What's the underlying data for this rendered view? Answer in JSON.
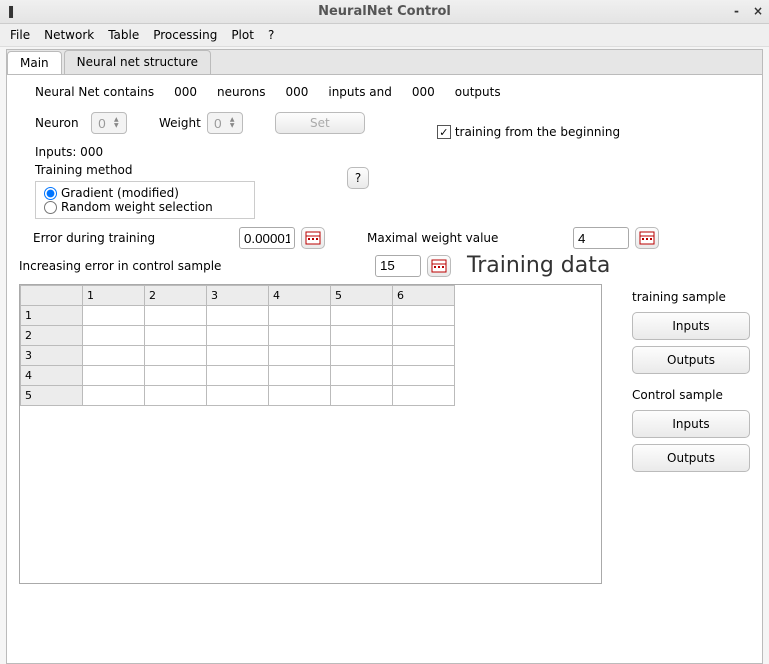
{
  "window": {
    "title": "NeuralNet Control"
  },
  "menu": {
    "file": "File",
    "network": "Network",
    "table": "Table",
    "processing": "Processing",
    "plot": "Plot",
    "help": "?"
  },
  "tabs": {
    "main": "Main",
    "structure": "Neural net structure"
  },
  "summary": {
    "prefix": "Neural Net contains",
    "neurons_count": "000",
    "neurons_label": "neurons",
    "inputs_count": "000",
    "inputs_label": "inputs and",
    "outputs_count": "000",
    "outputs_label": "outputs"
  },
  "neuron": {
    "label": "Neuron",
    "value": "0"
  },
  "weight": {
    "label": "Weight",
    "value": "0"
  },
  "set_button": "Set",
  "training_checkbox": {
    "checked": true,
    "label": "training from the beginning"
  },
  "inputs_line": "Inputs: 000",
  "training_method": {
    "label": "Training method",
    "help": "?",
    "opt1": "Gradient (modified)",
    "opt2": "Random weight selection",
    "selected": 0
  },
  "error_training": {
    "label": "Error during training",
    "value": "0.00001"
  },
  "max_weight": {
    "label": "Maximal weight value",
    "value": "4"
  },
  "increasing_error": {
    "label": "Increasing error in control sample",
    "value": "15"
  },
  "training_data_title": "Training data",
  "table": {
    "cols": [
      "1",
      "2",
      "3",
      "4",
      "5",
      "6"
    ],
    "rows": [
      "1",
      "2",
      "3",
      "4",
      "5"
    ]
  },
  "side": {
    "training_sample": "training sample",
    "control_sample": "Control sample",
    "inputs": "Inputs",
    "outputs": "Outputs"
  }
}
